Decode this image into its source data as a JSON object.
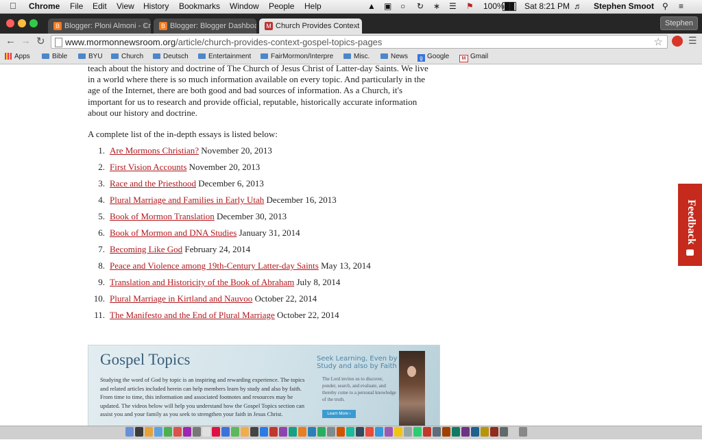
{
  "menubar": {
    "app": "Chrome",
    "menus": [
      "File",
      "Edit",
      "View",
      "History",
      "Bookmarks",
      "Window",
      "People",
      "Help"
    ],
    "battery": "100%",
    "clock": "Sat 8:21 PM",
    "user": "Stephen Smoot"
  },
  "tabs": [
    {
      "label": "Blogger: Ploni Almoni - Cr"
    },
    {
      "label": "Blogger: Blogger Dashboa"
    },
    {
      "label": "Church Provides Context"
    }
  ],
  "profile": "Stephen",
  "address": {
    "domain": "www.mormonnewsroom.org",
    "path": "/article/church-provides-context-gospel-topics-pages"
  },
  "bookmarks": [
    "Apps",
    "Bible",
    "BYU",
    "Church",
    "Deutsch",
    "Entertainment",
    "FairMormon/Interpre",
    "Misc.",
    "News",
    "Google",
    "Gmail"
  ],
  "article": {
    "paragraph": "teach about the history and doctrine of The Church of Jesus Christ of Latter-day Saints. We live in a world where there is so much information available on every topic. And particularly in the age of the Internet, there are both good and bad sources of information. As a Church, it's important for us to research and provide official, reputable, historically accurate information about our history and doctrine.",
    "intro": "A complete list of the in-depth essays is listed below:",
    "essays": [
      {
        "num": "1.",
        "title": "Are Mormons Christian?",
        "date": "November 20, 2013"
      },
      {
        "num": "2.",
        "title": "First Vision Accounts",
        "date": "November 20, 2013"
      },
      {
        "num": "3.",
        "title": "Race and the Priesthood",
        "date": "December 6, 2013"
      },
      {
        "num": "4.",
        "title": "Plural Marriage and Families in Early Utah",
        "date": "December 16, 2013"
      },
      {
        "num": "5.",
        "title": "Book of Mormon Translation",
        "date": "December 30, 2013"
      },
      {
        "num": "6.",
        "title": "Book of Mormon and DNA Studies",
        "date": "January 31, 2014"
      },
      {
        "num": "7.",
        "title": "Becoming Like God",
        "date": "February 24, 2014"
      },
      {
        "num": "8.",
        "title": "Peace and Violence among 19th-Century Latter-day Saints",
        "date": "May 13, 2014"
      },
      {
        "num": "9.",
        "title": "Translation and Historicity of the Book of Abraham",
        "date": "July 8, 2014"
      },
      {
        "num": "10.",
        "title": "Plural Marriage in Kirtland and Nauvoo",
        "date": "October 22, 2014"
      },
      {
        "num": "11.",
        "title": "The Manifesto and the End of Plural Marriage",
        "date": "October 22, 2014"
      }
    ]
  },
  "banner": {
    "title": "Gospel Topics",
    "body": "Studying the word of God by topic is an inspiring and rewarding experience. The topics and related articles included herein can help members learn by study and also by faith. From time to time, this information and associated footnotes and resources may be updated. The videos below will help you understand how the Gospel Topics section can assist you and your family as you seek to strengthen your faith in Jesus Christ.",
    "seek": "Seek Learning, Even by Study and also by Faith",
    "invite": "The Lord invites us to discover, ponder, search, and evaluate, and thereby come to a personal knowledge of the truth.",
    "learn_more": "Learn More ›"
  },
  "feedback": "Feedback",
  "colors": {
    "link": "#b0161b",
    "feedback": "#c52a1c",
    "banner_title": "#3a5f7d"
  }
}
